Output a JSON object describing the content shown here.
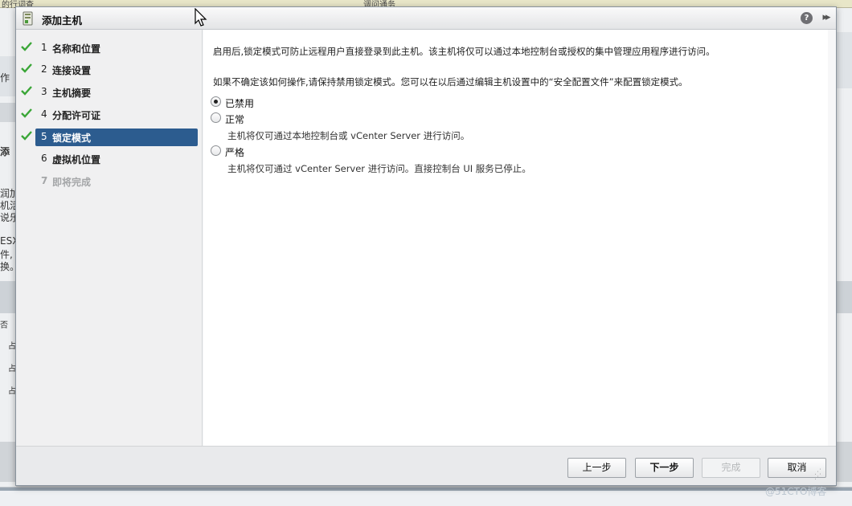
{
  "background": {
    "top_left_text": "的行词查",
    "top_mid_text": "调问通务",
    "left_fragments": [
      "作",
      "添",
      "润加",
      "机活",
      "说乐",
      "ESX",
      "件,",
      "换。",
      "否",
      "占",
      "占",
      "占"
    ]
  },
  "dialog": {
    "title": "添加主机",
    "help_icon_text": "?",
    "expand_icon_text": "▸▸"
  },
  "steps": [
    {
      "num": "1",
      "label": "名称和位置",
      "state": "done"
    },
    {
      "num": "2",
      "label": "连接设置",
      "state": "done"
    },
    {
      "num": "3",
      "label": "主机摘要",
      "state": "done"
    },
    {
      "num": "4",
      "label": "分配许可证",
      "state": "done"
    },
    {
      "num": "5",
      "label": "锁定模式",
      "state": "active"
    },
    {
      "num": "6",
      "label": "虚拟机位置",
      "state": "pending"
    },
    {
      "num": "7",
      "label": "即将完成",
      "state": "disabled"
    }
  ],
  "content": {
    "desc1": "启用后,锁定模式可防止远程用户直接登录到此主机。该主机将仅可以通过本地控制台或授权的集中管理应用程序进行访问。",
    "desc2": "如果不确定该如何操作,请保持禁用锁定模式。您可以在以后通过编辑主机设置中的“安全配置文件”来配置锁定模式。",
    "options": [
      {
        "label": "已禁用",
        "checked": true,
        "help": ""
      },
      {
        "label": "正常",
        "checked": false,
        "help": "主机将仅可通过本地控制台或 vCenter Server 进行访问。"
      },
      {
        "label": "严格",
        "checked": false,
        "help": "主机将仅可通过 vCenter Server 进行访问。直接控制台 UI 服务已停止。"
      }
    ]
  },
  "footer": {
    "back": "上一步",
    "next": "下一步",
    "finish": "完成",
    "cancel": "取消"
  },
  "watermark": "@51CTO博客",
  "colors": {
    "active_step": "#2c5c8f",
    "check_green": "#3aa637"
  }
}
